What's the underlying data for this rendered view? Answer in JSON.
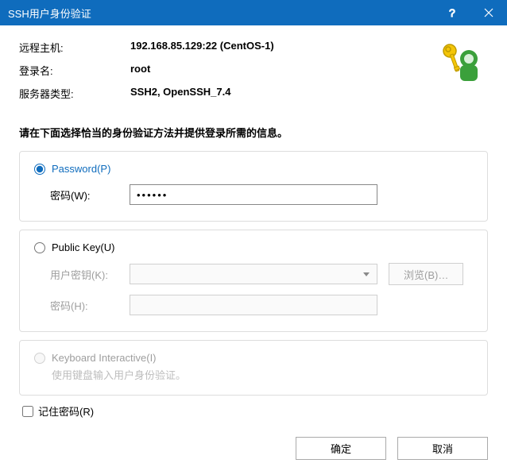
{
  "title": "SSH用户身份验证",
  "info": {
    "remote_host_label": "远程主机:",
    "remote_host_value": "192.168.85.129:22 (CentOS-1)",
    "login_name_label": "登录名:",
    "login_name_value": "root",
    "server_type_label": "服务器类型:",
    "server_type_value": "SSH2, OpenSSH_7.4"
  },
  "instruction": "请在下面选择恰当的身份验证方法并提供登录所需的信息。",
  "password_group": {
    "radio_label": "Password(P)",
    "field_label": "密码(W):",
    "value": "••••••"
  },
  "publickey_group": {
    "radio_label": "Public Key(U)",
    "user_key_label": "用户密钥(K):",
    "browse_label": "浏览(B)…",
    "password_label": "密码(H):"
  },
  "keyboard_group": {
    "radio_label": "Keyboard Interactive(I)",
    "desc": "使用键盘输入用户身份验证。"
  },
  "remember_label": "记住密码(R)",
  "ok_label": "确定",
  "cancel_label": "取消"
}
